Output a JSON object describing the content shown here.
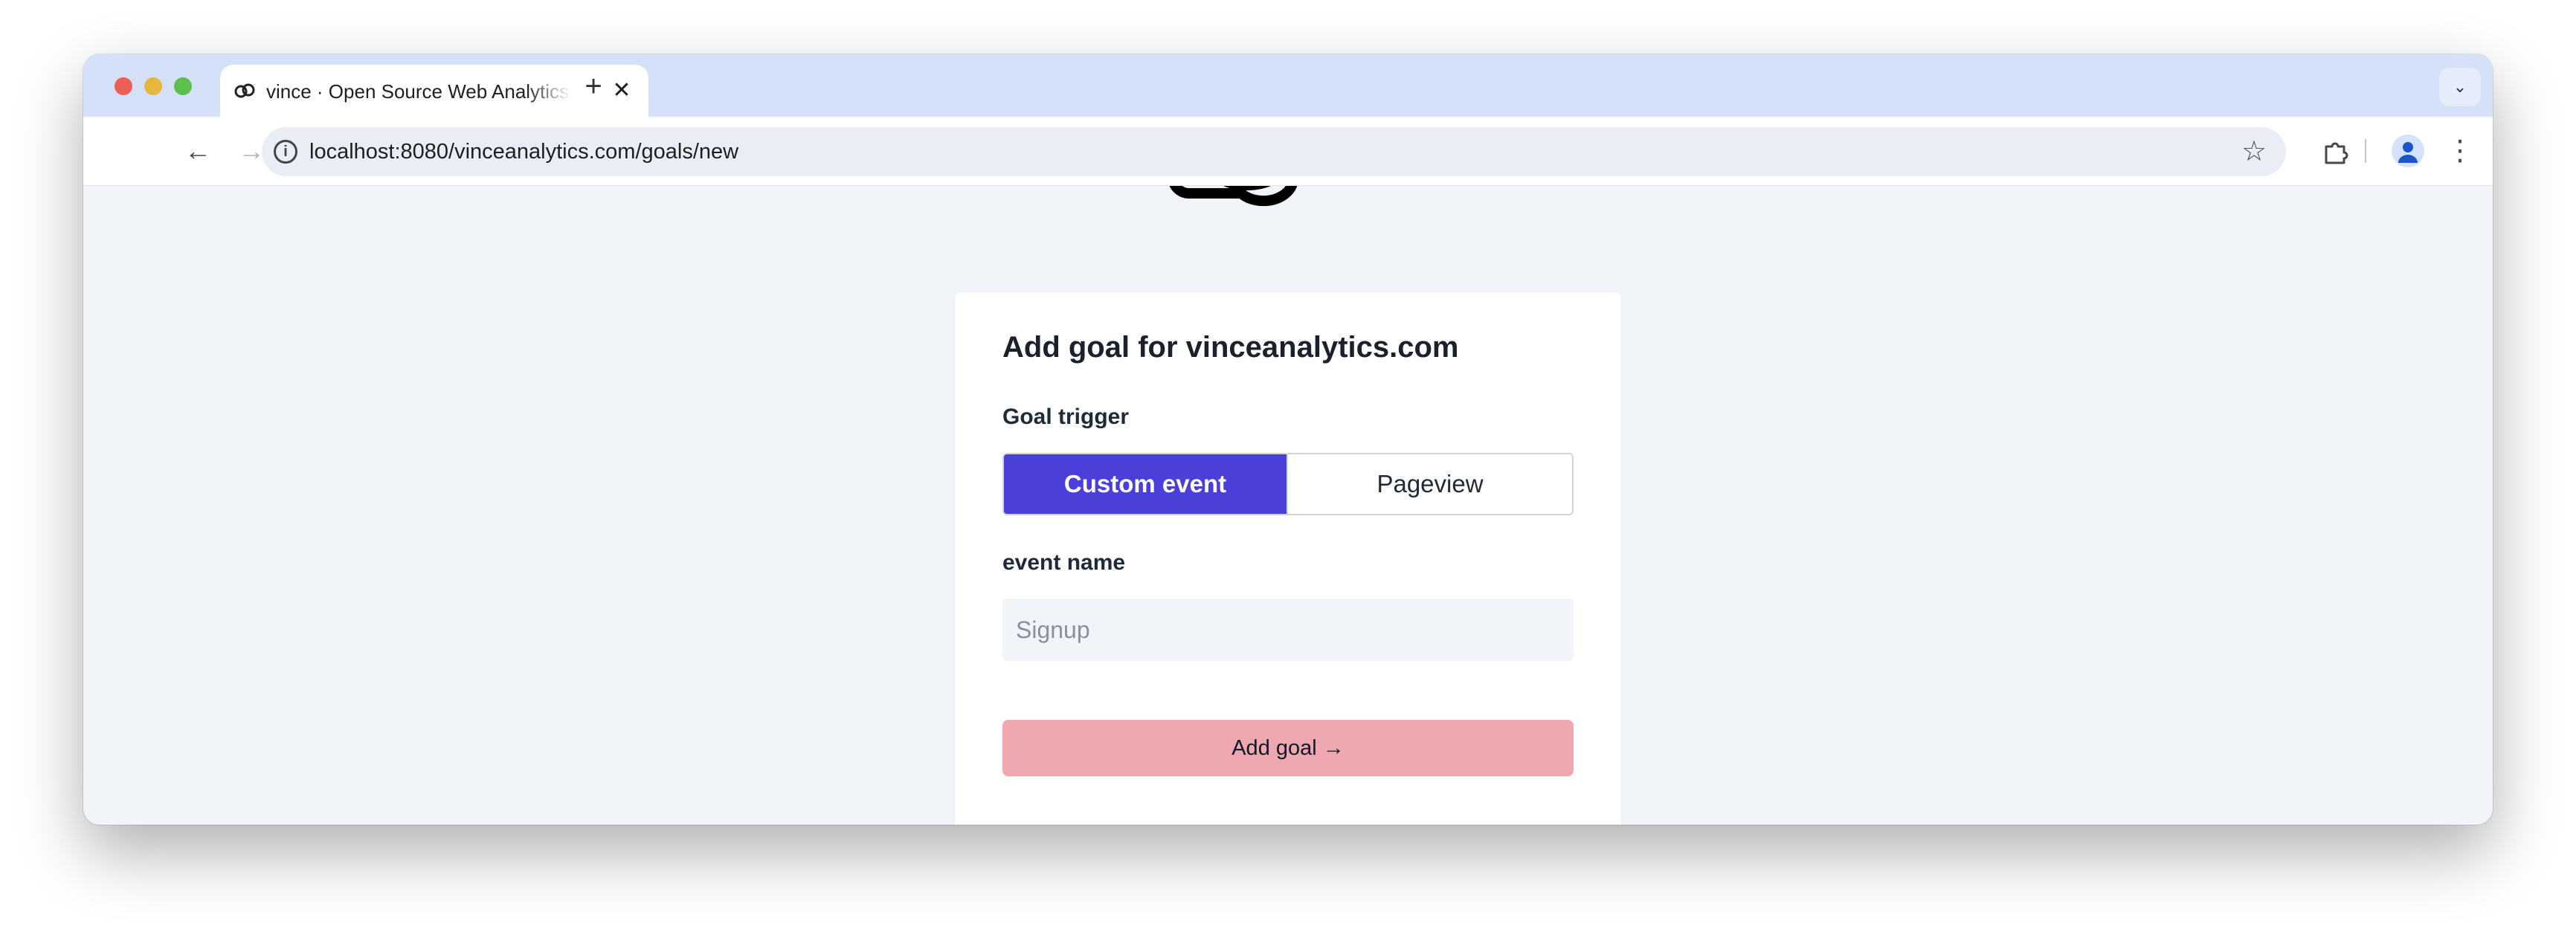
{
  "browser": {
    "tab": {
      "title": "vince · Open Source Web Analytics",
      "close_glyph": "✕"
    },
    "new_tab_glyph": "+",
    "tab_search_glyph": "⌄",
    "url": "localhost:8080/vinceanalytics.com/goals/new",
    "icons": {
      "back": "←",
      "forward": "→",
      "reload": "↻",
      "info": "i",
      "bookmark": "☆",
      "extensions": "puzzle",
      "menu": "⋮"
    }
  },
  "page": {
    "title": "Add goal for vinceanalytics.com",
    "goal_trigger": {
      "label": "Goal trigger",
      "options": [
        "Custom event",
        "Pageview"
      ],
      "selected": "Custom event"
    },
    "event_name": {
      "label": "event name",
      "placeholder": "Signup",
      "value": ""
    },
    "submit_label": "Add goal →"
  },
  "colors": {
    "accent": "#4a3fd9",
    "submit_disabled": "#f0a8b0",
    "background": "#f1f4f9"
  }
}
